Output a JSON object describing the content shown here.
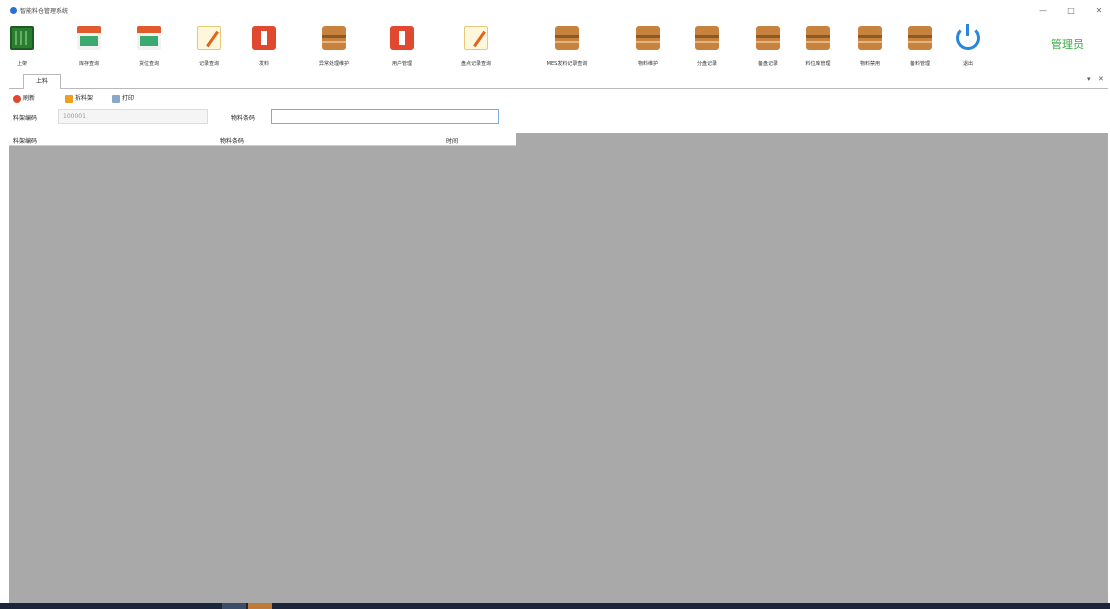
{
  "window": {
    "title": "智能料仓管理系统",
    "minimize_glyph": "—",
    "maximize_glyph": "□",
    "close_glyph": "✕"
  },
  "toolbar": {
    "items": [
      {
        "label": "上架",
        "icon": "circuit-board-icon"
      },
      {
        "label": "库存查询",
        "icon": "storefront-icon"
      },
      {
        "label": "货位查询",
        "icon": "storefront-icon"
      },
      {
        "label": "记录查询",
        "icon": "notepad-pen-icon"
      },
      {
        "label": "发料",
        "icon": "red-dispatch-icon"
      },
      {
        "label": "异常处理维护",
        "icon": "cabinet-box-icon"
      },
      {
        "label": "用户管理",
        "icon": "red-dispatch-icon"
      },
      {
        "label": "盘点记录查询",
        "icon": "notepad-pen-icon"
      },
      {
        "label": "MES发料记录查询",
        "icon": "cabinet-box-icon"
      },
      {
        "label": "物料维护",
        "icon": "cabinet-box-icon"
      },
      {
        "label": "分盘记录",
        "icon": "cabinet-box-icon"
      },
      {
        "label": "备盘记录",
        "icon": "cabinet-box-icon"
      },
      {
        "label": "料位库管理",
        "icon": "cabinet-box-icon"
      },
      {
        "label": "物料禁用",
        "icon": "cabinet-box-icon"
      },
      {
        "label": "备料管理",
        "icon": "cabinet-box-icon"
      },
      {
        "label": "退出",
        "icon": "power-icon"
      }
    ],
    "user_role": "管理员"
  },
  "tabs": {
    "active_tab": "上料",
    "pin_glyph": "▾",
    "close_glyph": "✕"
  },
  "actions": {
    "refresh_label": "刷新",
    "split_label": "拆料架",
    "print_label": "打印"
  },
  "form": {
    "rack_code_label": "料架编码",
    "rack_code_value": "100001",
    "material_code_label": "物料条码",
    "material_code_value": ""
  },
  "table": {
    "columns": [
      "料架编码",
      "物料条码",
      "时间"
    ],
    "rows": []
  },
  "colors": {
    "accent_green": "#39a845",
    "grid_background": "#a9a9a9",
    "power_blue": "#2a86d8"
  }
}
